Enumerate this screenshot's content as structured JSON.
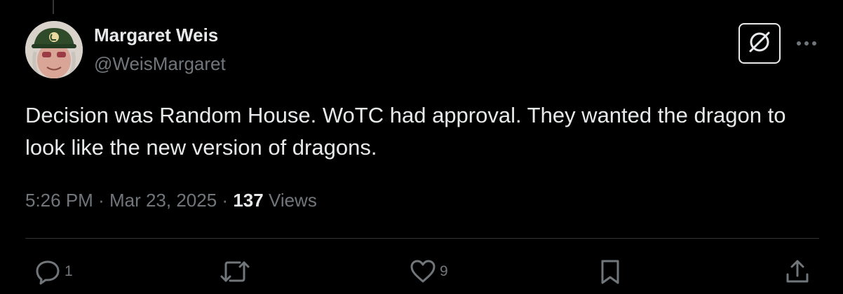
{
  "post": {
    "author_name": "Margaret Weis",
    "author_handle": "@WeisMargaret",
    "text": "Decision was Random House. WoTC had approval. They wanted the dragon to look like the new version of dragons.",
    "time": "5:26 PM",
    "separator": "·",
    "date": "Mar 23, 2025",
    "views_count": "137",
    "views_label": "Views"
  },
  "actions": {
    "reply_count": "1",
    "like_count": "9"
  },
  "icons": {
    "grok": "grok-icon",
    "more": "more-icon",
    "reply": "reply-icon",
    "repost": "repost-icon",
    "like": "like-icon",
    "bookmark": "bookmark-icon",
    "share": "share-icon"
  },
  "colors": {
    "background": "#000000",
    "primary_text": "#e7e9ea",
    "secondary_text": "#71767b",
    "divider": "#2f3336"
  }
}
